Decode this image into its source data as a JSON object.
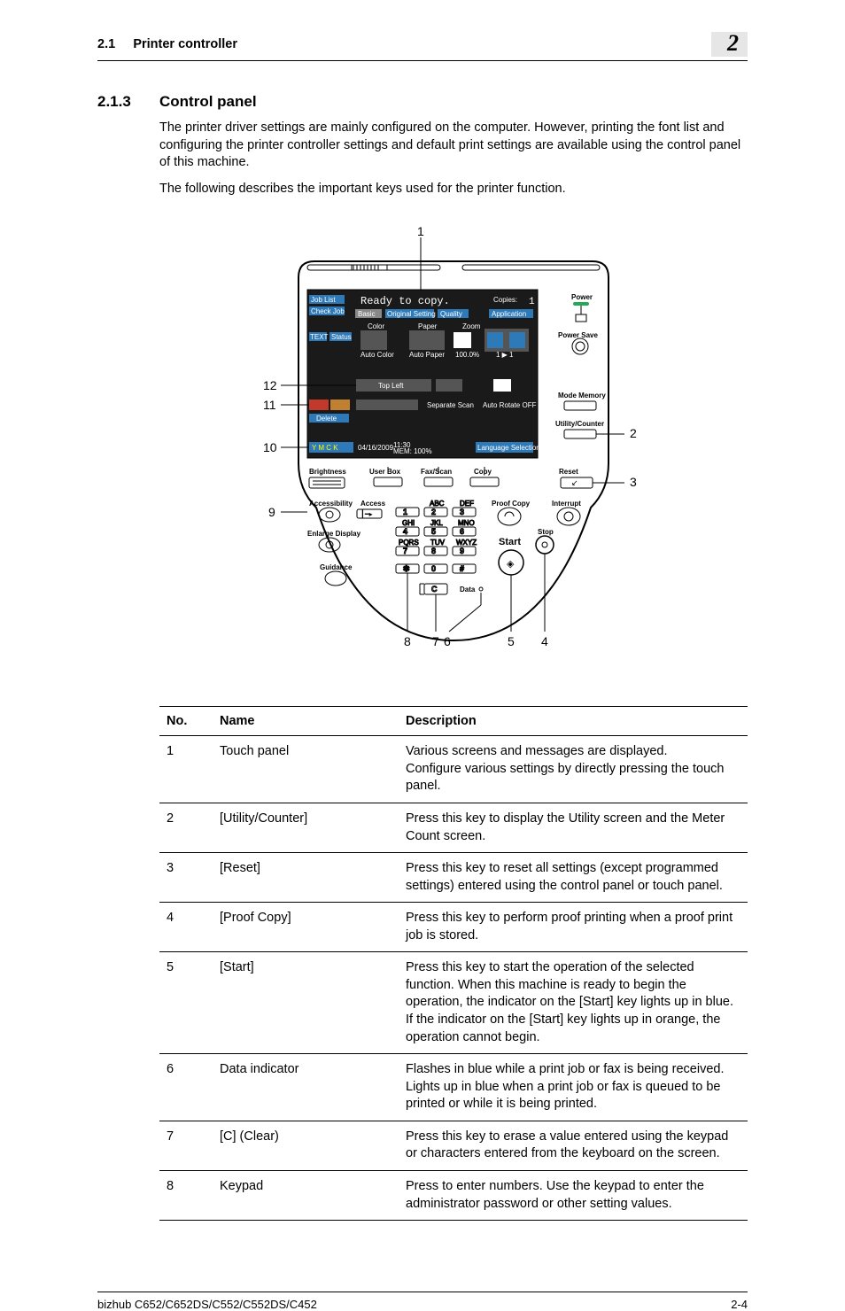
{
  "header": {
    "section_num": "2.1",
    "section_title": "Printer controller",
    "chapter_badge": "2"
  },
  "heading": {
    "num": "2.1.3",
    "title": "Control panel"
  },
  "paragraphs": {
    "p1": "The printer driver settings are mainly configured on the computer. However, printing the font list and configuring the printer controller settings and default print settings are available using the control panel of this machine.",
    "p2": "The following describes the important keys used for the printer function."
  },
  "figure": {
    "callouts": {
      "c1": "1",
      "c2": "2",
      "c3": "3",
      "c4": "4",
      "c5": "5",
      "c6": "6",
      "c7": "7",
      "c8": "8",
      "c9": "9",
      "c10": "10",
      "c11": "11",
      "c12": "12"
    },
    "screen": {
      "job_list": "Job List",
      "check_job": "Check Job",
      "ready": "Ready to copy.",
      "copies": "Copies:",
      "copy_count": "1",
      "basic": "Basic",
      "orig_setting": "Original Setting",
      "quality": "Quality",
      "application": "Application",
      "color": "Color",
      "paper": "Paper",
      "zoom": "Zoom",
      "test": "TEXT",
      "status": "Status",
      "auto_color": "Auto Color",
      "auto_paper": "Auto Paper",
      "hundred": "100.0%",
      "one_one": "1 ▶ 1",
      "top_left": "Top Left",
      "delete": "Delete",
      "separate_scan": "Separate Scan",
      "auto_rotate": "Auto Rotate OFF",
      "date": "04/16/2009",
      "time": "11:30",
      "memory": "MEM: 100%",
      "lang_sel": "Language Selection"
    },
    "labels": {
      "power": "Power",
      "power_save": "Power Save",
      "mode_memory": "Mode Memory",
      "utility_counter": "Utility/Counter",
      "reset": "Reset",
      "interrupt": "Interrupt",
      "stop": "Stop",
      "start": "Start",
      "proof_copy": "Proof Copy",
      "brightness": "Brightness",
      "user_box": "User Box",
      "fax_scan": "Fax/Scan",
      "copy": "Copy",
      "accessibility": "Accessibility",
      "access": "Access",
      "enlarge_display": "Enlarge Display",
      "guidance": "Guidance",
      "data": "Data",
      "abc": "ABC",
      "def": "DEF",
      "ghi": "GHI",
      "jkl": "JKL",
      "mno": "MNO",
      "pqrs": "PQRS",
      "tuv": "TUV",
      "wxyz": "WXYZ",
      "keys": {
        "k1": "1",
        "k2": "2",
        "k3": "3",
        "k4": "4",
        "k5": "5",
        "k6": "6",
        "k7": "7",
        "k8": "8",
        "k9": "9",
        "k0": "0",
        "kstar": "✱",
        "khash": "#",
        "kc": "C"
      }
    }
  },
  "table": {
    "headers": {
      "no": "No.",
      "name": "Name",
      "description": "Description"
    },
    "rows": [
      {
        "no": "1",
        "name": "Touch panel",
        "desc": "Various screens and messages are displayed.\nConfigure various settings by directly pressing the touch panel."
      },
      {
        "no": "2",
        "name": "[Utility/Counter]",
        "desc": "Press this key to display the Utility screen and the Meter Count screen."
      },
      {
        "no": "3",
        "name": "[Reset]",
        "desc": "Press this key to reset all settings (except programmed settings) entered using the control panel or touch panel."
      },
      {
        "no": "4",
        "name": "[Proof Copy]",
        "desc": "Press this key to perform proof printing when a proof print job is stored."
      },
      {
        "no": "5",
        "name": "[Start]",
        "desc": "Press this key to start the operation of the selected function. When this machine is ready to begin the operation, the indicator on the [Start] key lights up in blue. If the indicator on the [Start] key lights up in orange, the operation cannot begin."
      },
      {
        "no": "6",
        "name": "Data indicator",
        "desc": "Flashes in blue while a print job or fax is being received. Lights up in blue when a print job or fax is queued to be printed or while it is being printed."
      },
      {
        "no": "7",
        "name": "[C] (Clear)",
        "desc": "Press this key to erase a value entered using the keypad or characters entered from the keyboard on the screen."
      },
      {
        "no": "8",
        "name": "Keypad",
        "desc": "Press to enter numbers. Use the keypad to enter the administrator password or other setting values."
      }
    ]
  },
  "footer": {
    "left": "bizhub C652/C652DS/C552/C552DS/C452",
    "right": "2-4"
  }
}
